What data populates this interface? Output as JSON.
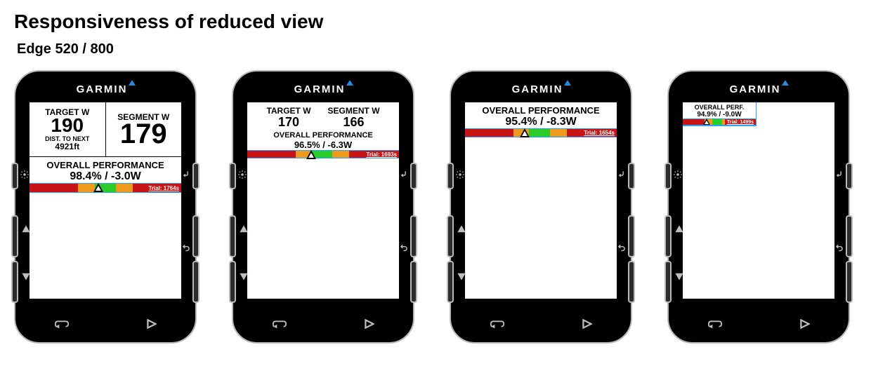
{
  "page": {
    "title": "Responsiveness of reduced view",
    "subtitle": "Edge 520 / 800"
  },
  "brand": "GARMIN",
  "gauge_colors": {
    "red": "#c81414",
    "orange": "#f09a1c",
    "green": "#2acc2a",
    "outline": "#2aa3ff"
  },
  "devices": [
    {
      "target_label": "TARGET W",
      "target_value": "190",
      "segment_label": "SEGMENT W",
      "segment_value": "179",
      "dist_label": "DIST. TO NEXT",
      "dist_value": "4921ft",
      "perf_label": "OVERALL PERFORMANCE",
      "perf_value": "98.4% / -3.0W",
      "trial": "Trial: 1764s"
    },
    {
      "target_label": "TARGET W",
      "target_value": "170",
      "segment_label": "SEGMENT W",
      "segment_value": "166",
      "perf_label": "OVERALL PERFORMANCE",
      "perf_value": "96.5% / -6.3W",
      "trial": "Trial: 1693s"
    },
    {
      "perf_label": "OVERALL PERFORMANCE",
      "perf_value": "95.4% / -8.3W",
      "trial": "Trial: 1654s"
    },
    {
      "perf_label": "OVERALL PERF.",
      "perf_value": "94.9% / -9.0W",
      "trial": "Trial: 1499s"
    }
  ]
}
